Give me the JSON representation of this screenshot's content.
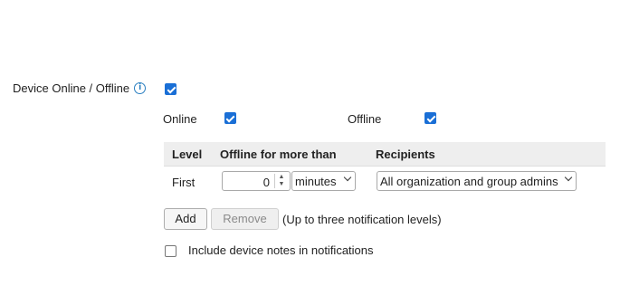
{
  "device_status": {
    "label": "Device Online / Offline",
    "info_icon": "info-icon",
    "enabled": true,
    "online_label": "Online",
    "online_checked": true,
    "offline_label": "Offline",
    "offline_checked": true
  },
  "table": {
    "headers": {
      "level": "Level",
      "offline_for": "Offline for more than",
      "recipients": "Recipients"
    },
    "rows": [
      {
        "level": "First",
        "offline_value": "0",
        "unit": "minutes",
        "recipients": "All organization and group admins"
      }
    ]
  },
  "actions": {
    "add_label": "Add",
    "remove_label": "Remove",
    "hint": "(Up to three notification levels)"
  },
  "notes": {
    "label": "Include device notes in notifications",
    "checked": false
  },
  "colors": {
    "checkbox_blue": "#1a6fd6",
    "info_blue": "#2a7fc1",
    "header_bg": "#eeeeee"
  }
}
